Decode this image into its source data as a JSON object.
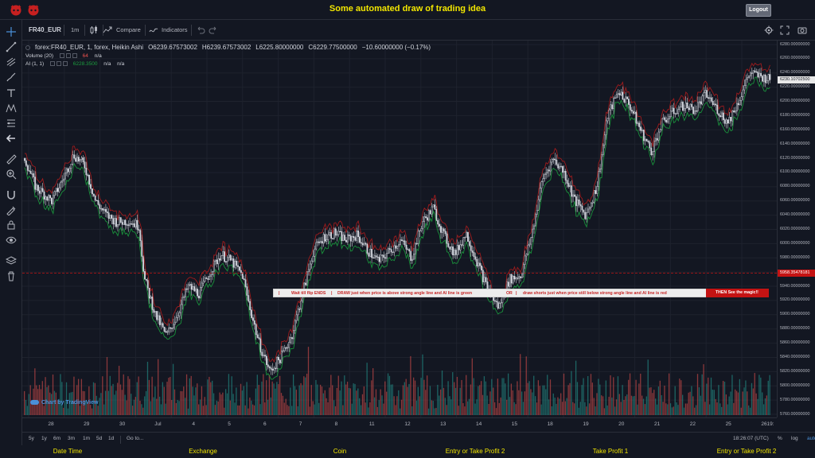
{
  "page": {
    "title": "Some automated draw of trading idea",
    "logout_label": "Logout"
  },
  "toolbar": {
    "symbol": "FR40_EUR",
    "interval": "1m",
    "compare_label": "Compare",
    "indicators_label": "Indicators"
  },
  "legend": {
    "symbol_line": "forex:FR40_EUR, 1, forex, Heikin Ashi",
    "open": "O6239.67573002",
    "high": "H6239.67573002",
    "low": "L6225.80000000",
    "close": "C6229.77500000",
    "change": "−10.60000000 (−0.17%)",
    "volume_label": "Volume (20)",
    "volume_value": "64",
    "volume_na": "n/a",
    "ai_label": "AI (1, 1)",
    "ai_value": "6228.3500",
    "ai_na1": "n/a",
    "ai_na2": "n/a"
  },
  "banner": {
    "part1": "Wait till flip ENDS",
    "part2": "DRAW just when price is above strong angle line and AI line is green",
    "part3": "OR",
    "part4": "draw shorts just when price still below strong angle line and AI line is red",
    "magic": "THEN See the magic!!"
  },
  "price_scale": {
    "labels": [
      "6280.00000000",
      "6260.00000000",
      "6240.00000000",
      "6220.00000000",
      "6200.00000000",
      "6180.00000000",
      "6160.00000000",
      "6140.00000000",
      "6120.00000000",
      "6100.00000000",
      "6080.00000000",
      "6060.00000000",
      "6040.00000000",
      "6020.00000000",
      "6000.00000000",
      "5980.00000000",
      "5960.00000000",
      "5940.00000000",
      "5920.00000000",
      "5900.00000000",
      "5880.00000000",
      "5860.00000000",
      "5840.00000000",
      "5820.00000000",
      "5800.00000000",
      "5780.00000000",
      "5760.00000000"
    ],
    "current_price": "6230.10702500",
    "line_price": "5958.35478181"
  },
  "time_scale": {
    "labels": [
      "28",
      "29",
      "30",
      "Jul",
      "4",
      "5",
      "6",
      "7",
      "8",
      "11",
      "12",
      "13",
      "14",
      "15",
      "18",
      "19",
      "20",
      "21",
      "22",
      "25",
      "26"
    ],
    "edge_label": "19:"
  },
  "bottom_bar": {
    "ranges": [
      "5y",
      "1y",
      "6m",
      "3m",
      "1m",
      "5d",
      "1d"
    ],
    "goto_label": "Go to...",
    "clock": "18:26:07 (UTC)",
    "percent_label": "%",
    "log_label": "log",
    "auto_label": "auto"
  },
  "tv_logo": "Chart by TradingView",
  "footer": {
    "items": [
      "Date Time",
      "Exchange",
      "Coin",
      "Entry or Take Profit 2",
      "Take Profit 1",
      "Entry or Take Profit 2"
    ]
  },
  "colors": {
    "background": "#131722",
    "up_volume": "#26a69a",
    "down_volume": "#ef5350",
    "ai_green": "#1b9e3e",
    "ai_red": "#b71c1c",
    "title_yellow": "#f2e600",
    "banner_red": "#c41313"
  },
  "chart_data": {
    "type": "candlestick",
    "price_range": [
      5760,
      6280
    ],
    "y_ticks": [
      6280,
      6260,
      6240,
      6220,
      6200,
      6180,
      6160,
      6140,
      6120,
      6100,
      6080,
      6060,
      6040,
      6020,
      6000,
      5980,
      5960,
      5940,
      5920,
      5900,
      5880,
      5860,
      5840,
      5820,
      5800,
      5780,
      5760
    ],
    "price_path": [
      [
        0,
        6120
      ],
      [
        2,
        6080
      ],
      [
        5,
        6060
      ],
      [
        7,
        6090
      ],
      [
        9,
        6125
      ],
      [
        11,
        6110
      ],
      [
        13,
        6060
      ],
      [
        15,
        6040
      ],
      [
        17,
        6030
      ],
      [
        19,
        6032
      ],
      [
        21,
        6025
      ],
      [
        22,
        5950
      ],
      [
        24,
        5900
      ],
      [
        26,
        5870
      ],
      [
        28,
        5900
      ],
      [
        30,
        5940
      ],
      [
        32,
        5930
      ],
      [
        34,
        5960
      ],
      [
        36,
        5985
      ],
      [
        38,
        5975
      ],
      [
        40,
        5955
      ],
      [
        41,
        5920
      ],
      [
        43,
        5860
      ],
      [
        45,
        5820
      ],
      [
        47,
        5840
      ],
      [
        49,
        5870
      ],
      [
        51,
        5930
      ],
      [
        53,
        5990
      ],
      [
        55,
        6010
      ],
      [
        57,
        6015
      ],
      [
        59,
        6005
      ],
      [
        61,
        6012
      ],
      [
        63,
        5990
      ],
      [
        65,
        5975
      ],
      [
        67,
        5990
      ],
      [
        69,
        6005
      ],
      [
        71,
        5980
      ],
      [
        73,
        6030
      ],
      [
        75,
        6050
      ],
      [
        77,
        6010
      ],
      [
        79,
        5985
      ],
      [
        81,
        6015
      ],
      [
        83,
        5975
      ],
      [
        85,
        5935
      ],
      [
        87,
        5910
      ],
      [
        89,
        5950
      ],
      [
        91,
        5955
      ],
      [
        93,
        6010
      ],
      [
        95,
        6090
      ],
      [
        97,
        6120
      ],
      [
        99,
        6100
      ],
      [
        101,
        6060
      ],
      [
        103,
        6040
      ],
      [
        105,
        6080
      ],
      [
        107,
        6180
      ],
      [
        109,
        6215
      ],
      [
        111,
        6195
      ],
      [
        113,
        6160
      ],
      [
        115,
        6130
      ],
      [
        117,
        6170
      ],
      [
        119,
        6185
      ],
      [
        121,
        6195
      ],
      [
        123,
        6188
      ],
      [
        125,
        6210
      ],
      [
        127,
        6190
      ],
      [
        129,
        6170
      ],
      [
        131,
        6200
      ],
      [
        133,
        6240
      ],
      [
        135,
        6235
      ],
      [
        137,
        6230
      ]
    ],
    "session_count": 138
  }
}
